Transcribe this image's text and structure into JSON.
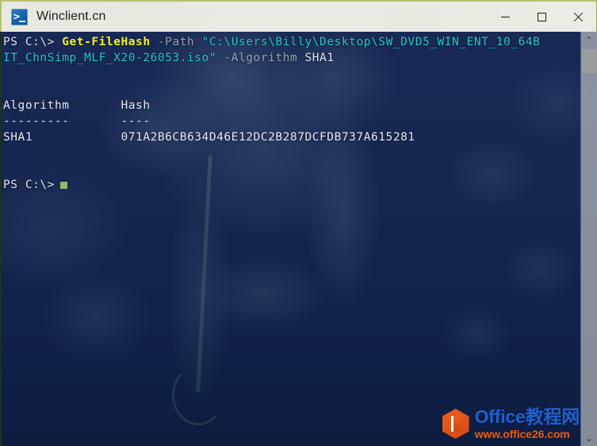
{
  "window": {
    "title": "Winclient.cn",
    "icon": "powershell-icon",
    "controls": {
      "minimize": "—",
      "maximize": "□",
      "close": "✕"
    }
  },
  "console": {
    "lines": [
      {
        "segments": [
          {
            "text": "PS C:\\> ",
            "color": "white"
          },
          {
            "text": "Get-FileHash",
            "color": "yellow"
          },
          {
            "text": " -Path ",
            "color": "gray"
          },
          {
            "text": "\"C:\\Users\\Billy\\Desktop\\SW_DVD5_WIN_ENT_10_64B",
            "color": "cyan"
          }
        ]
      },
      {
        "segments": [
          {
            "text": "IT_ChnSimp_MLF_X20-26053.iso\"",
            "color": "cyan"
          },
          {
            "text": " -Algorithm ",
            "color": "gray"
          },
          {
            "text": "SHA1",
            "color": "white"
          }
        ]
      },
      {
        "segments": [
          {
            "text": "",
            "color": "out"
          }
        ]
      },
      {
        "segments": [
          {
            "text": "",
            "color": "out"
          }
        ]
      },
      {
        "segments": [
          {
            "text": "Algorithm       Hash",
            "color": "out"
          }
        ]
      },
      {
        "segments": [
          {
            "text": "---------       ----",
            "color": "out"
          }
        ]
      },
      {
        "segments": [
          {
            "text": "SHA1            071A2B6CB634D46E12DC2B287DCFDB737A615281",
            "color": "out"
          }
        ]
      },
      {
        "segments": [
          {
            "text": "",
            "color": "out"
          }
        ]
      },
      {
        "segments": [
          {
            "text": "",
            "color": "out"
          }
        ]
      },
      {
        "segments": [
          {
            "text": "PS C:\\>",
            "color": "white"
          }
        ],
        "cursor": true
      }
    ],
    "command": {
      "prompt": "PS C:\\>",
      "cmdlet": "Get-FileHash",
      "param_path_name": "-Path",
      "param_path_value": "\"C:\\Users\\Billy\\Desktop\\SW_DVD5_WIN_ENT_10_64BIT_ChnSimp_MLF_X20-26053.iso\"",
      "param_algorithm_name": "-Algorithm",
      "param_algorithm_value": "SHA1"
    },
    "output_table": {
      "headers": [
        "Algorithm",
        "Hash"
      ],
      "rows": [
        [
          "SHA1",
          "071A2B6CB634D46E12DC2B287DCFDB737A615281"
        ]
      ]
    },
    "colors": {
      "background": "#12275a",
      "prompt_text": "#dfe4ec",
      "cmdlet": "#f2f22c",
      "parameter": "#9aa3ae",
      "string": "#27c6c6",
      "output": "#e6ebf2",
      "cursor": "#9ab86a"
    }
  },
  "scrollbar": {
    "up_arrow": "⌃",
    "down_arrow": "⌄"
  },
  "watermark": {
    "title": "Office教程网",
    "url": "www.office26.com",
    "logo": "office-hexagon-logo",
    "title_color": "#1f63d6",
    "url_color": "#f0600f",
    "logo_color": "#f4601f"
  }
}
